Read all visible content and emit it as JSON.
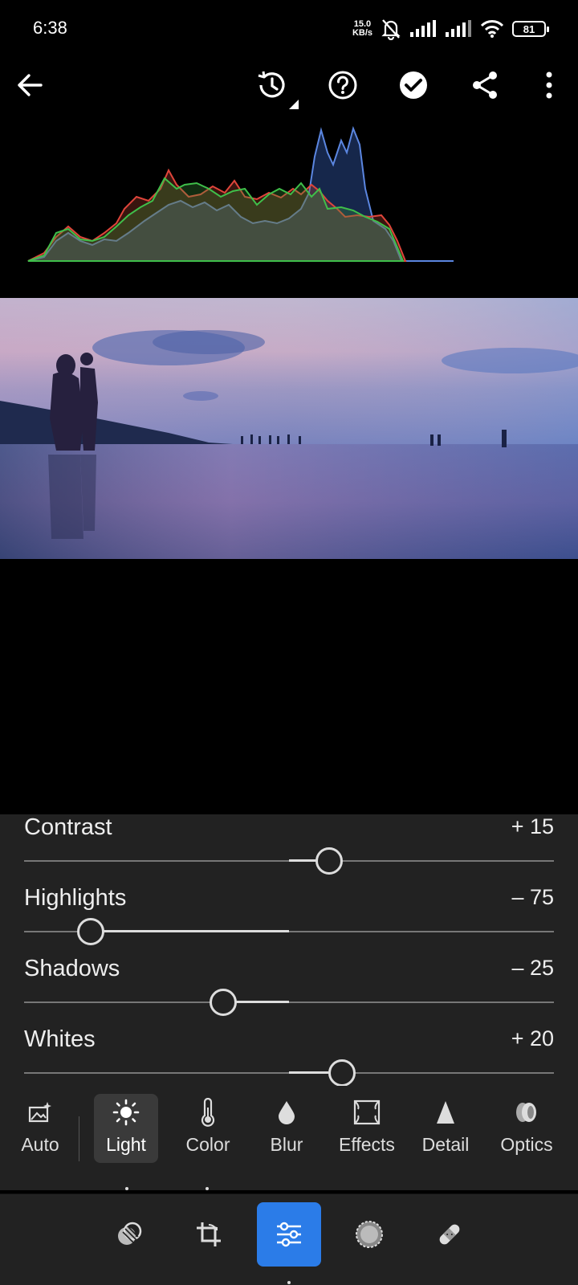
{
  "status_bar": {
    "time": "6:38",
    "net_speed_value": "15.0",
    "net_speed_unit": "KB/s",
    "battery": "81"
  },
  "toolbar": {
    "icons": [
      "back-arrow-icon",
      "history-icon",
      "help-icon",
      "done-check-icon",
      "share-icon",
      "more-vertical-icon"
    ]
  },
  "adjustments": [
    {
      "label": "Contrast",
      "value": "+ 15",
      "level": 15
    },
    {
      "label": "Highlights",
      "value": "– 75",
      "level": -75
    },
    {
      "label": "Shadows",
      "value": "– 25",
      "level": -25
    },
    {
      "label": "Whites",
      "value": "+ 20",
      "level": 20
    }
  ],
  "tools": {
    "auto": "Auto",
    "light": "Light",
    "color": "Color",
    "blur": "Blur",
    "effects": "Effects",
    "detail": "Detail",
    "optics": "Optics",
    "active": "Light"
  },
  "bottom_nav": {
    "icons": [
      "selective-icon",
      "crop-icon",
      "edit-sliders-icon",
      "masking-icon",
      "healing-icon"
    ],
    "active": "edit-sliders-icon"
  },
  "colors": {
    "accent": "#2b7ce8",
    "panel": "#222222",
    "hist_red": "#e0453b",
    "hist_green": "#3fbf4a",
    "hist_blue": "#3f6fd8"
  }
}
